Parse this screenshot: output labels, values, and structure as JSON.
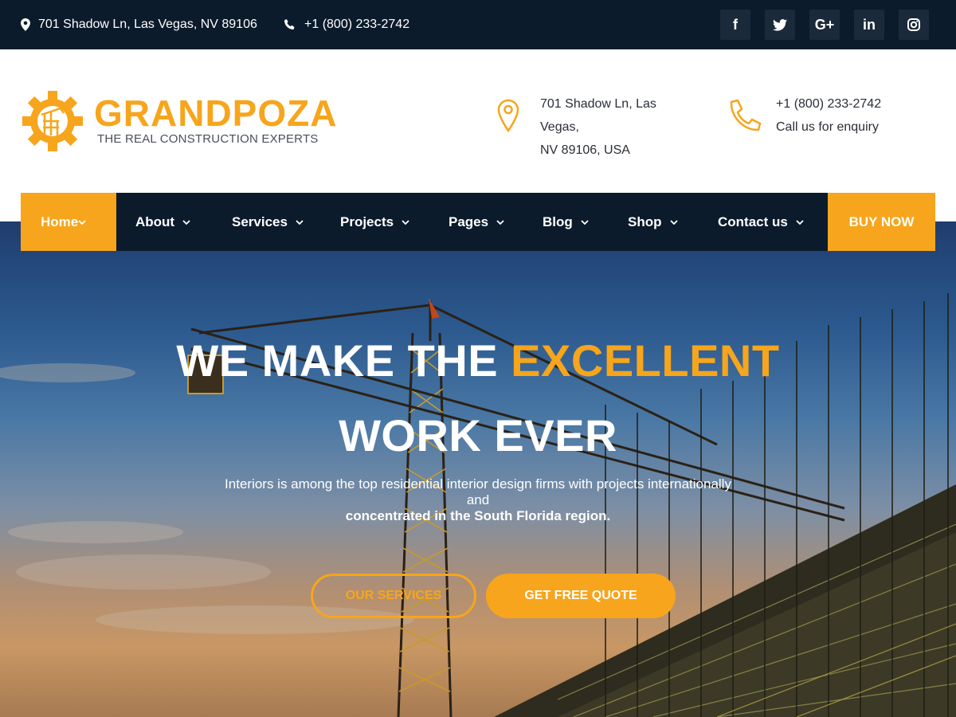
{
  "topbar": {
    "address": "701 Shadow Ln, Las Vegas, NV 89106",
    "phone": "+1 (800) 233-2742",
    "social": [
      {
        "icon": "facebook-icon",
        "glyph": "f"
      },
      {
        "icon": "twitter-icon",
        "glyph": "t"
      },
      {
        "icon": "google-plus-icon",
        "glyph": "G+"
      },
      {
        "icon": "linkedin-icon",
        "glyph": "in"
      },
      {
        "icon": "instagram-icon",
        "glyph": "ig"
      }
    ]
  },
  "header": {
    "logo_name": "GRANDPOZA",
    "logo_tagline": "THE REAL CONSTRUCTION EXPERTS",
    "address_line1": "701 Shadow Ln, Las",
    "address_line2": "Vegas,",
    "address_line3": "NV 89106, USA",
    "phone": "+1 (800) 233-2742",
    "phone_caption": "Call us for enquiry"
  },
  "nav": {
    "items": [
      {
        "label": "Home"
      },
      {
        "label": "About"
      },
      {
        "label": "Services"
      },
      {
        "label": "Projects"
      },
      {
        "label": "Pages"
      },
      {
        "label": "Blog"
      },
      {
        "label": "Shop"
      },
      {
        "label": "Contact us"
      }
    ],
    "buy_now": "BUY NOW"
  },
  "hero": {
    "title_part1": "WE MAKE THE ",
    "title_accent": "EXCELLENT",
    "title_line2": "WORK EVER",
    "desc_line1": "Interiors is among the top residential interior design firms with projects internationally",
    "desc_line2": "and",
    "desc_line3": "concentrated in the South Florida region.",
    "btn_services": "OUR SERVICES",
    "btn_quote": "GET FREE QUOTE"
  },
  "colors": {
    "accent": "#f7a51c",
    "dark": "#0b1b2b"
  }
}
